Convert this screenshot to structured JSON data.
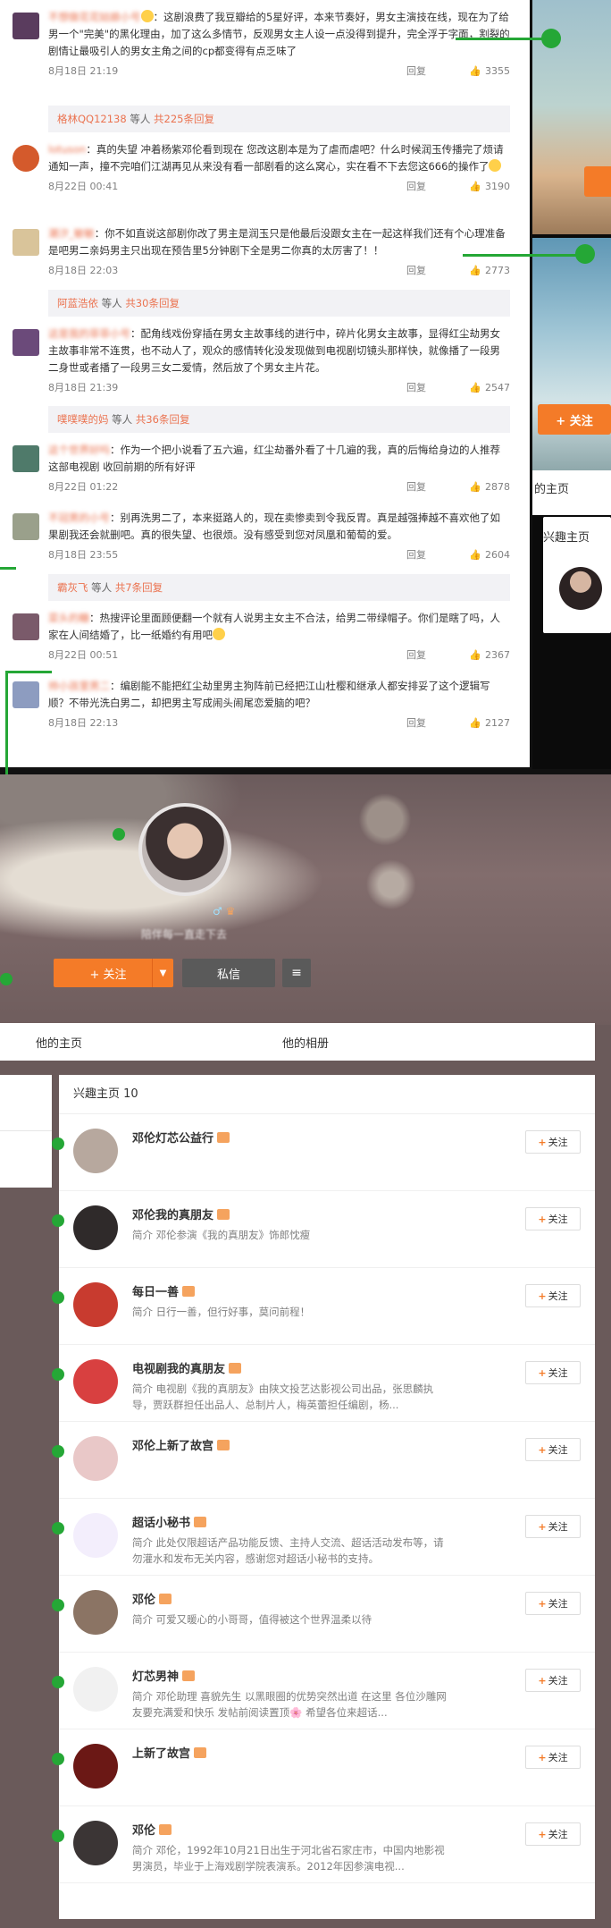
{
  "comments": [
    {
      "nick": "不想做花花姑娘小号",
      "text": "：这剧浪费了我豆瓣给的5星好评，本来节奏好，男女主演技在线，现在为了给男一个\"完美\"的黑化理由，加了这么多情节，反观男女主人设一点没得到提升，完全浮于字面，割裂的剧情让最吸引人的男女主角之间的cp都变得有点乏味了",
      "time": "8月18日 21:19",
      "reply": "回复",
      "likes": "3355",
      "sub": {
        "who": "格林QQ12138",
        "rest": " 等人 ",
        "cnt": "共225条回复"
      }
    },
    {
      "nick": "lotuson",
      "text": "：真的失望 冲着杨紫邓伦看到现在 您改这剧本是为了虐而虐吧？什么时候润玉传播完了烦请通知一声，撞不完咱们江湖再见从来没有看一部剧看的这么窝心，实在看不下去您这666的操作了",
      "time": "8月22日 00:41",
      "reply": "回复",
      "likes": "3190"
    },
    {
      "nick": "潮汐_敏敏",
      "text": "：你不如直说这部剧你改了男主是润玉只是他最后没跟女主在一起这样我们还有个心理准备是吧男二亲妈男主只出现在预告里5分钟剧下全是男二你真的太厉害了！！",
      "time": "8月18日 22:03",
      "reply": "回复",
      "likes": "2773",
      "sub": {
        "who": "阿蓝浩依",
        "rest": " 等人 ",
        "cnt": "共30条回复"
      }
    },
    {
      "nick": "这是我的菲菲小号",
      "text": "：配角线戏份穿插在男女主故事线的进行中，碎片化男女主故事，显得红尘劫男女主故事非常不连贯，也不动人了，观众的感情转化没发现做到电视剧切镜头那样快，就像播了一段男二身世或者播了一段男三女二爱情，然后放了个男女主片花。",
      "time": "8月18日 21:39",
      "reply": "回复",
      "likes": "2547",
      "sub": {
        "who": "噗噗噗的妈",
        "rest": " 等人 ",
        "cnt": "共36条回复"
      }
    },
    {
      "nick": "这个世界好吗",
      "text": "：作为一个把小说看了五六遍，红尘劫番外看了十几遍的我，真的后悔给身边的人推荐这部电视剧 收回前期的所有好评",
      "time": "8月22日 01:22",
      "reply": "回复",
      "likes": "2878"
    },
    {
      "nick": "不冠男的小号",
      "text": "：别再洗男二了，本来挺路人的，现在卖惨卖到令我反胃。真是越强捧越不喜欢他了如果剧我还会就删吧。真的很失望、也很烦。没有感受到您对凤凰和葡萄的爱。",
      "time": "8月18日 23:55",
      "reply": "回复",
      "likes": "2604",
      "sub": {
        "who": "霸灰飞",
        "rest": " 等人 ",
        "cnt": "共7条回复"
      }
    },
    {
      "nick": "菜头的糖",
      "text": "：热搜评论里面顾便翻一个就有人说男主女主不合法，给男二带绿帽子。你们是瞎了吗，人家在人间结婚了，比一纸婚约有用吧",
      "time": "8月22日 00:51",
      "reply": "回复",
      "likes": "2367"
    },
    {
      "nick": "帅小孩里男二",
      "text": "：编剧能不能把红尘劫里男主狗阵前已经把江山杜樱和继承人都安排妥了这个逻辑写顺？不带光洗白男二，却把男主写成闹头闹尾恋爱脑的吧？",
      "time": "8月18日 22:13",
      "reply": "回复",
      "likes": "2127"
    }
  ],
  "collage": {
    "follow_label": "+ 关注",
    "home_label": "的主页",
    "interest_label": "兴趣主页"
  },
  "profile": {
    "signature": "陪伴每一直走下去",
    "follow_label": "+ 关注",
    "message_label": "私信",
    "more_icon": "≡",
    "tab_home": "他的主页",
    "tab_album": "他的相册"
  },
  "interest": {
    "title": "兴趣主页 10",
    "follow_label": "关注",
    "items": [
      {
        "name": "邓伦灯芯公益行",
        "desc": "",
        "avatar": "#b7a89e"
      },
      {
        "name": "邓伦我的真朋友",
        "desc": "简介  邓伦参演《我的真朋友》饰郎忱瘦",
        "avatar": "#2f2a2a"
      },
      {
        "name": "每日一善",
        "desc": "简介  日行一善，但行好事，莫问前程！",
        "avatar": "#c83b2f"
      },
      {
        "name": "电视剧我的真朋友",
        "desc": "简介  电视剧《我的真朋友》由陕文投艺达影视公司出品，张思麟执导，贾跃群担任出品人、总制片人，梅英蕾担任编剧，杨...",
        "avatar": "#d84040"
      },
      {
        "name": "邓伦上新了故宫",
        "desc": "",
        "avatar": "#e9c8c8"
      },
      {
        "name": "超话小秘书",
        "desc": "简介  此处仅限超话产品功能反馈、主持人交流、超话活动发布等，请勿灌水和发布无关内容，感谢您对超话小秘书的支持。",
        "avatar": "#f3eefc"
      },
      {
        "name": "邓伦",
        "desc": "简介  可爱又暖心的小哥哥，值得被这个世界温柔以待",
        "avatar": "#8b7464"
      },
      {
        "name": "灯芯男神",
        "desc": "简介  邓伦助理 喜貌先生 以黑眼圈的优势突然出道 在这里 各位沙雕网友要充满爱和快乐 发帖前阅读置顶🌸 希望各位来超话...",
        "avatar": "#f1f1f1"
      },
      {
        "name": "上新了故宫",
        "desc": "",
        "avatar": "#6b1815"
      },
      {
        "name": "邓伦",
        "desc": "简介  邓伦，1992年10月21日出生于河北省石家庄市，中国内地影视男演员，毕业于上海戏剧学院表演系。2012年因参演电视...",
        "avatar": "#3b3535"
      }
    ]
  },
  "colors": {
    "accent": "#f47b28",
    "link": "#eb7350",
    "annotation": "#25a736"
  }
}
